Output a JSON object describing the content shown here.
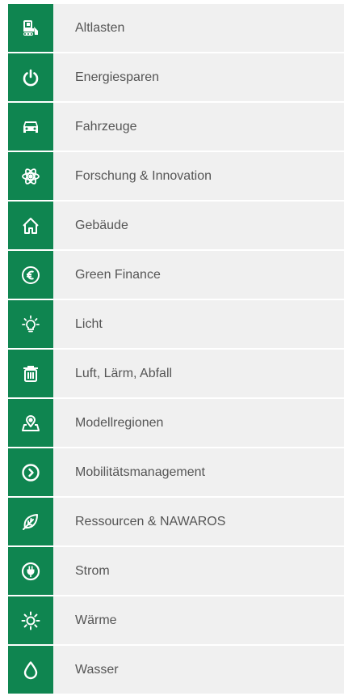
{
  "menu": {
    "items": [
      {
        "label": "Altlasten",
        "icon": "excavator-icon"
      },
      {
        "label": "Energiesparen",
        "icon": "power-icon"
      },
      {
        "label": "Fahrzeuge",
        "icon": "car-icon"
      },
      {
        "label": "Forschung & Innovation",
        "icon": "atom-icon"
      },
      {
        "label": "Gebäude",
        "icon": "house-icon"
      },
      {
        "label": "Green Finance",
        "icon": "euro-icon"
      },
      {
        "label": "Licht",
        "icon": "lightbulb-icon"
      },
      {
        "label": "Luft, Lärm, Abfall",
        "icon": "trash-icon"
      },
      {
        "label": "Modellregionen",
        "icon": "map-pin-icon"
      },
      {
        "label": "Mobilitätsmanagement",
        "icon": "circle-chevron-icon"
      },
      {
        "label": "Ressourcen & NAWAROS",
        "icon": "leaf-icon"
      },
      {
        "label": "Strom",
        "icon": "plug-icon"
      },
      {
        "label": "Wärme",
        "icon": "sun-icon"
      },
      {
        "label": "Wasser",
        "icon": "water-drop-icon"
      }
    ]
  },
  "colors": {
    "icon_bg": "#0f8550",
    "label_bg": "#f0f0f0",
    "label_text": "#555555",
    "icon_fg": "#ffffff"
  }
}
